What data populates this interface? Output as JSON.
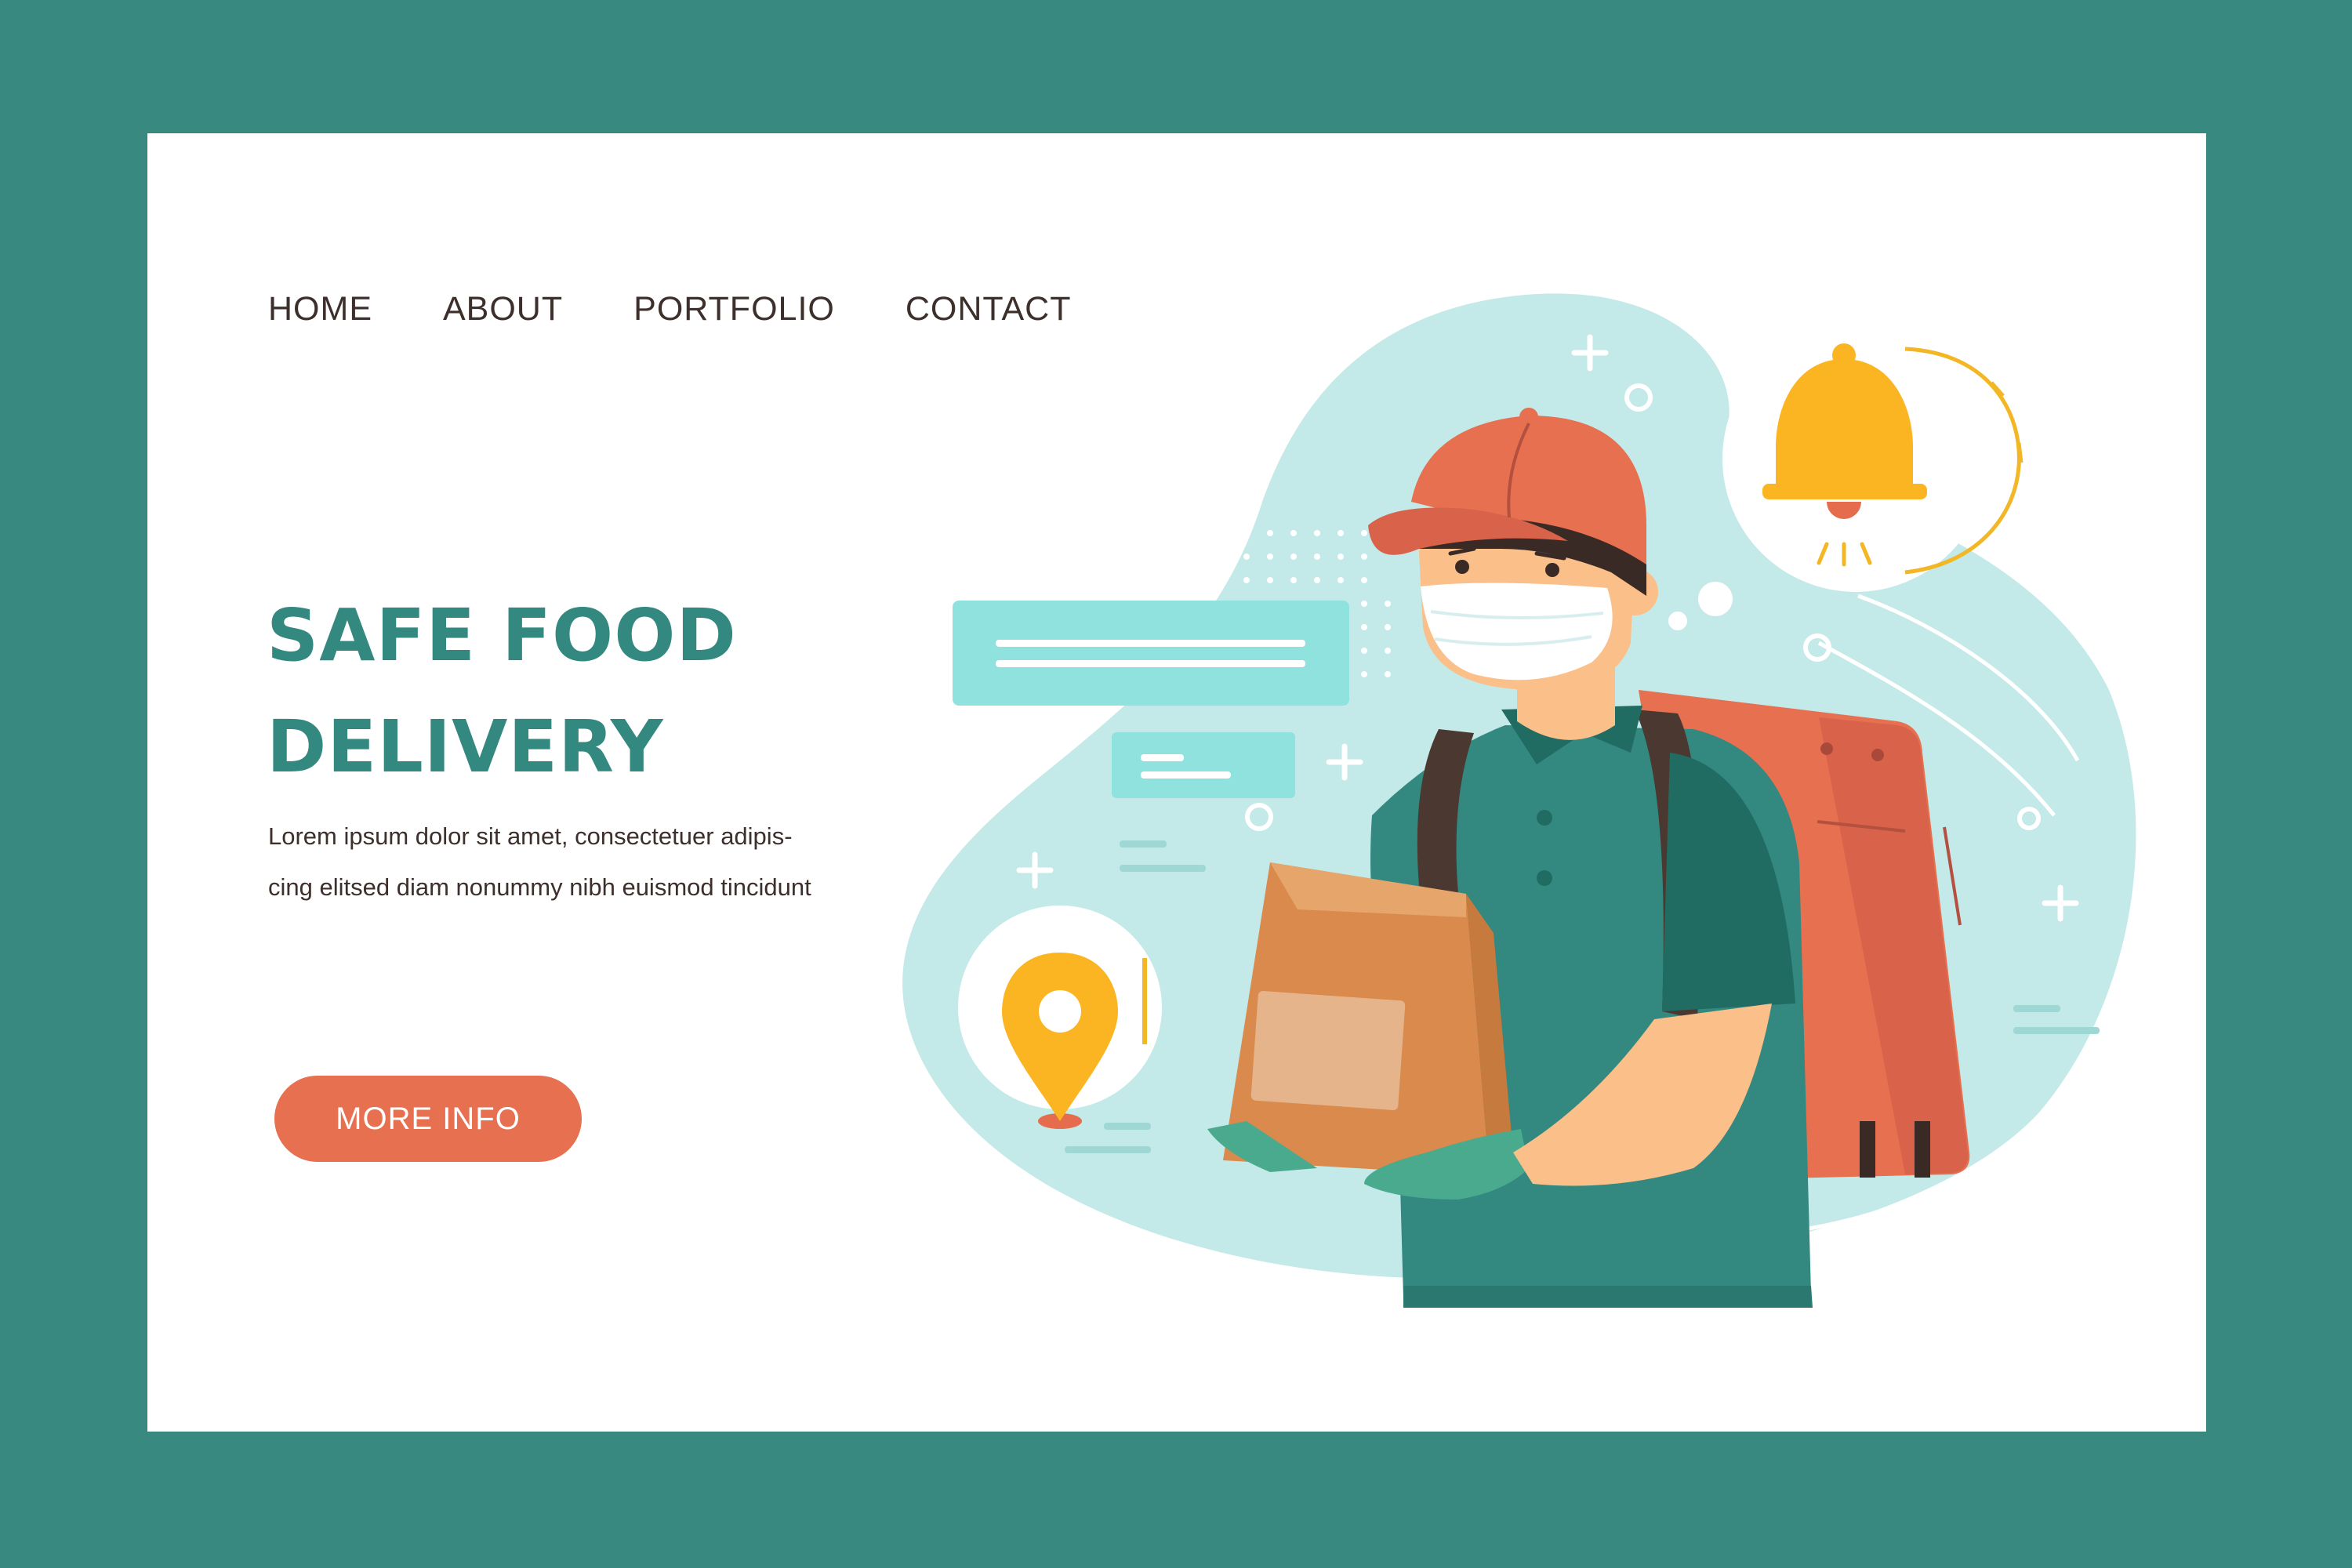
{
  "nav": {
    "items": [
      {
        "label": "HOME"
      },
      {
        "label": "ABOUT"
      },
      {
        "label": "PORTFOLIO"
      },
      {
        "label": "CONTACT"
      }
    ]
  },
  "hero": {
    "title_line1": "SAFE FOOD",
    "title_line2": "DELIVERY",
    "text_line1": "Lorem ipsum dolor sit amet, consectetuer adipis-",
    "text_line2": "cing elitsed diam nonummy nibh euismod tincidunt",
    "button_label": "MORE INFO"
  },
  "colors": {
    "background": "#388980",
    "accent": "#338880",
    "button": "#e6704f",
    "blob": "#c3e9e8"
  },
  "illustration": {
    "icons": [
      "bell-icon",
      "location-pin-icon",
      "delivery-person",
      "paper-bag",
      "delivery-backpack"
    ]
  }
}
